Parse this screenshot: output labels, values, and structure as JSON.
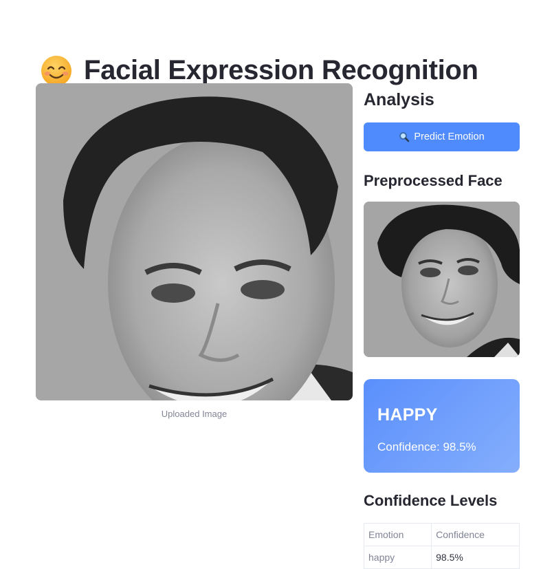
{
  "header": {
    "title": "Facial Expression Recognition",
    "title_icon": "smiling-face-emoji"
  },
  "upload": {
    "caption": "Uploaded Image"
  },
  "analysis": {
    "heading": "Analysis",
    "predict_button": {
      "icon": "magnifier-icon",
      "label": "Predict Emotion"
    },
    "preprocessed_heading": "Preprocessed Face",
    "result": {
      "emotion": "HAPPY",
      "confidence_text": "Confidence: 98.5%",
      "confidence_value": 98.5
    },
    "confidence_heading": "Confidence Levels",
    "table": {
      "headers": [
        "Emotion",
        "Confidence"
      ],
      "rows": [
        {
          "emotion": "happy",
          "confidence": "98.5%"
        }
      ]
    }
  },
  "colors": {
    "accent": "#4f8bfd",
    "card_gradient_start": "#5a8ffc",
    "card_gradient_end": "#85aefc"
  }
}
